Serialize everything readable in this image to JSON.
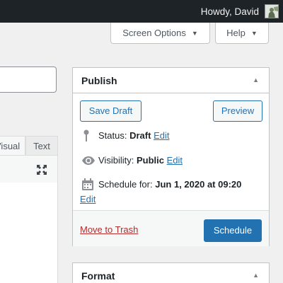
{
  "adminbar": {
    "greeting": "Howdy, David"
  },
  "screen_meta": {
    "screen_options_label": "Screen Options",
    "help_label": "Help"
  },
  "editor": {
    "tabs": {
      "visual": "Visual",
      "text": "Text"
    }
  },
  "publish": {
    "title": "Publish",
    "save_draft": "Save Draft",
    "preview": "Preview",
    "status_label": "Status:",
    "status_value": "Draft",
    "visibility_label": "Visibility:",
    "visibility_value": "Public",
    "schedule_label": "Schedule for:",
    "schedule_value": "Jun 1, 2020 at 09:20",
    "edit": "Edit",
    "move_to_trash": "Move to Trash",
    "schedule_button": "Schedule"
  },
  "format": {
    "title": "Format"
  },
  "icons": {
    "caret": "▼",
    "toggle": "▲"
  },
  "colors": {
    "adminbar": "#1d2327",
    "accent": "#2271b1",
    "trash": "#b32d2e",
    "background": "#f0f0f1"
  }
}
